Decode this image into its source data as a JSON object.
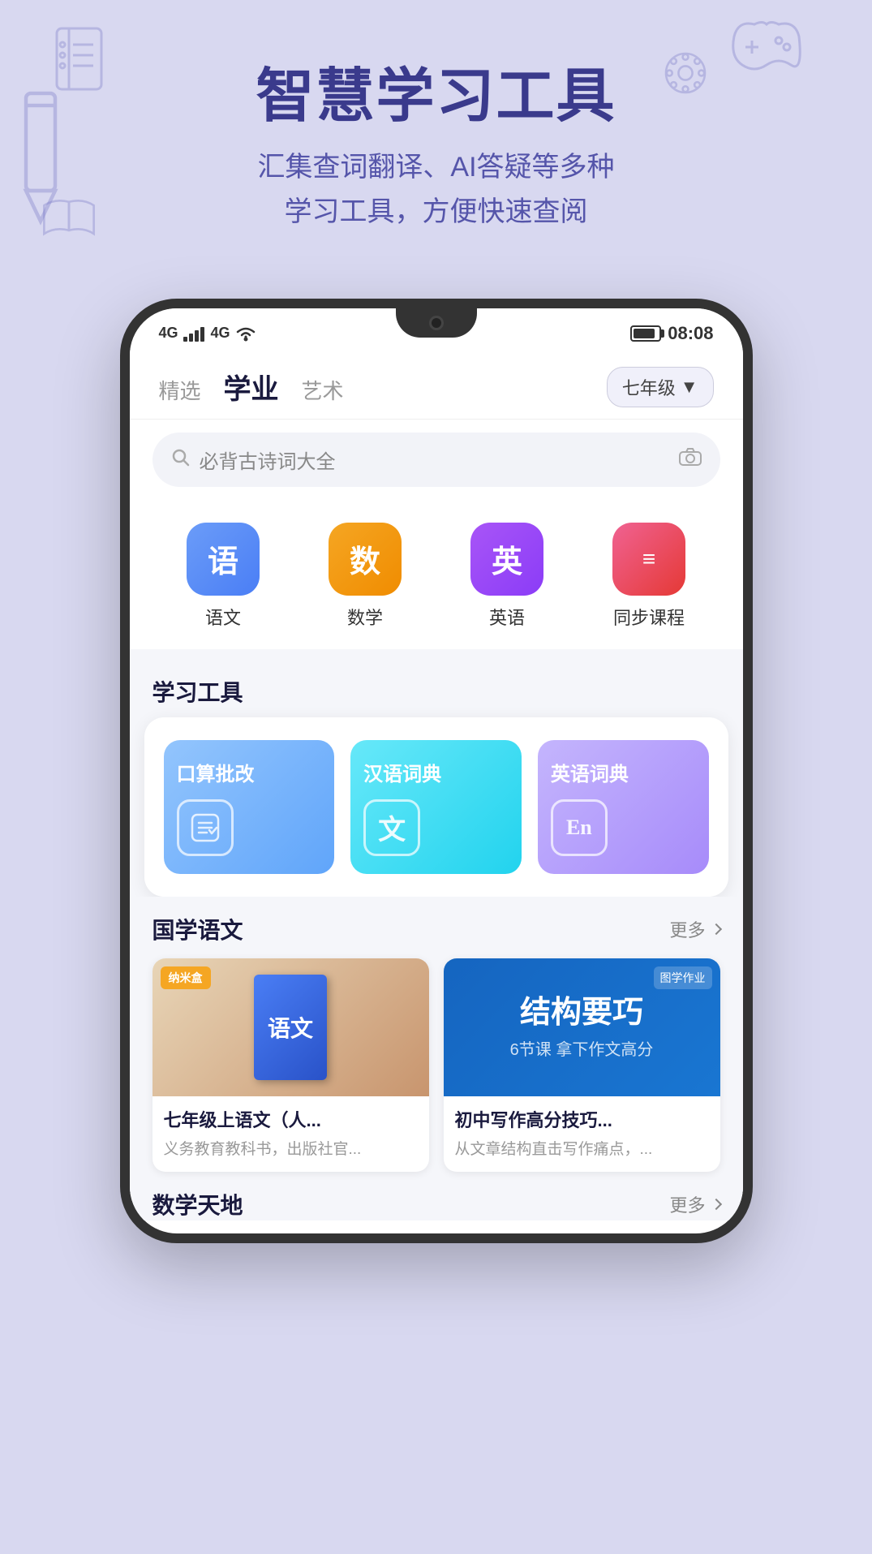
{
  "hero": {
    "title": "智慧学习工具",
    "subtitle": "汇集查词翻译、AI答疑等多种\n学习工具，方便快速查阅"
  },
  "statusBar": {
    "signal1": "4G",
    "signal2": "4G",
    "wifi": "WiFi",
    "time": "08:08"
  },
  "tabs": {
    "items": [
      {
        "label": "精选",
        "active": false
      },
      {
        "label": "学业",
        "active": true
      },
      {
        "label": "艺术",
        "active": false
      }
    ],
    "grade": "七年级",
    "gradeDropdown": "▼"
  },
  "search": {
    "placeholder": "必背古诗词大全"
  },
  "subjects": [
    {
      "label": "语文",
      "icon": "语",
      "type": "yuwen"
    },
    {
      "label": "数学",
      "icon": "数",
      "type": "shuxue"
    },
    {
      "label": "英语",
      "icon": "英",
      "type": "yingyu"
    },
    {
      "label": "同步课程",
      "icon": "≡",
      "type": "tongbu"
    }
  ],
  "learningTools": {
    "sectionTitle": "学习工具",
    "tools": [
      {
        "label": "口算批改",
        "icon": "⊞",
        "type": "kousan"
      },
      {
        "label": "汉语词典",
        "icon": "文",
        "type": "hanyu"
      },
      {
        "label": "英语词典",
        "icon": "En",
        "type": "yingyu-dict"
      }
    ]
  },
  "guoxueSection": {
    "title": "国学语文",
    "moreLabel": "更多",
    "cards": [
      {
        "title": "七年级上语文（人...",
        "desc": "义务教育教科书，出版社官...",
        "badge": "纳米盒",
        "textbookLabel": "语文"
      },
      {
        "title": "初中写作高分技巧...",
        "desc": "从文章结构直击写作痛点，...",
        "courseTitle": "结构要巧",
        "courseSubtitle": "6节课 拿下作文高分",
        "badge": "图学作业"
      }
    ]
  },
  "mathSection": {
    "title": "数学天地",
    "moreLabel": "更多"
  }
}
